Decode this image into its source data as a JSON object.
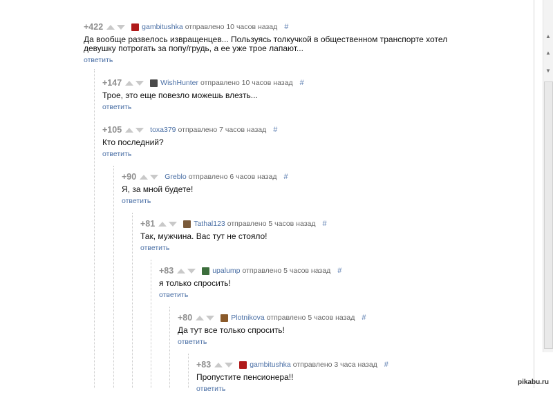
{
  "comments": [
    {
      "rating": "+422",
      "author": "gambitushka",
      "meta": "отправлено 10 часов назад",
      "hash": "#",
      "avatar_color": "#b01a1a",
      "text": "Да вообще развелось извращенцев... Пользуясь толкучкой в общественном транспорте хотел девушку потрогать за попу/грудь, а ее уже трое лапают...",
      "reply": "ответить"
    },
    {
      "rating": "+147",
      "author": "WishHunter",
      "meta": "отправлено 10 часов назад",
      "hash": "#",
      "avatar_color": "#4a4a4a",
      "text": "Трое, это еще повезло можешь влезть...",
      "reply": "ответить"
    },
    {
      "rating": "+105",
      "author": "toxa379",
      "meta": "отправлено 7 часов назад",
      "hash": "#",
      "avatar_color": "",
      "text": "Кто последний?",
      "reply": "ответить"
    },
    {
      "rating": "+90",
      "author": "Greblo",
      "meta": "отправлено 6 часов назад",
      "hash": "#",
      "avatar_color": "",
      "text": "Я, за мной будете!",
      "reply": "ответить"
    },
    {
      "rating": "+81",
      "author": "Tathal123",
      "meta": "отправлено 5 часов назад",
      "hash": "#",
      "avatar_color": "#7a5a3a",
      "text": "Так, мужчина. Вас тут не стояло!",
      "reply": "ответить"
    },
    {
      "rating": "+83",
      "author": "upalump",
      "meta": "отправлено 5 часов назад",
      "hash": "#",
      "avatar_color": "#3c6e3c",
      "text": "я только спросить!",
      "reply": "ответить"
    },
    {
      "rating": "+80",
      "author": "Plotnikova",
      "meta": "отправлено 5 часов назад",
      "hash": "#",
      "avatar_color": "#8a5a2a",
      "text": "Да тут все только спросить!",
      "reply": "ответить"
    },
    {
      "rating": "+83",
      "author": "gambitushka",
      "meta": "отправлено 3 часа назад",
      "hash": "#",
      "avatar_color": "#b01a1a",
      "text": "Пропустите пенсионера!!",
      "reply": "ответить"
    }
  ],
  "watermark": "pikabu.ru"
}
